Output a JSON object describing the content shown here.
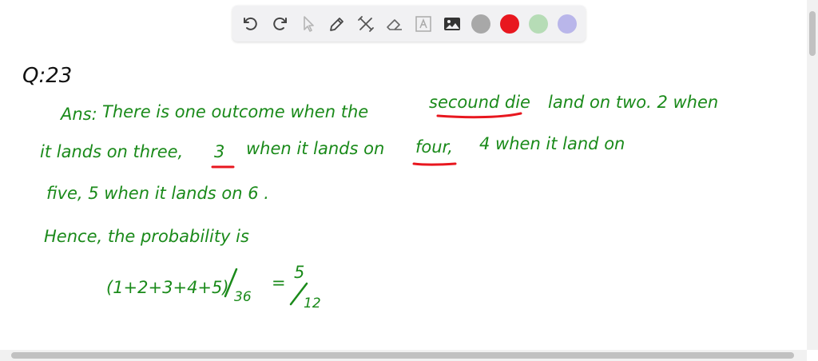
{
  "toolbar": {
    "tools": [
      {
        "name": "undo-icon"
      },
      {
        "name": "redo-icon"
      },
      {
        "name": "select-cursor-icon"
      },
      {
        "name": "pen-icon"
      },
      {
        "name": "tools-icon"
      },
      {
        "name": "eraser-icon"
      },
      {
        "name": "text-icon"
      },
      {
        "name": "image-icon"
      }
    ],
    "colors": [
      {
        "name": "gray",
        "hex": "#a8a8a8"
      },
      {
        "name": "red",
        "hex": "#e8171f"
      },
      {
        "name": "green",
        "hex": "#b6dcb6"
      },
      {
        "name": "lavender",
        "hex": "#b9b6ea"
      }
    ]
  },
  "notes": {
    "question": "Q:23",
    "ans_label": "Ans:",
    "line1": "There  is  one  outcome  when  the",
    "line1_u": "secound  die",
    "line1_end": "land  on  two.  2  when",
    "line2a": "it  lands  on  three,",
    "line2_u1": "3",
    "line2b": "when  it  lands  on",
    "line2_u2": "four,",
    "line2c": "4  when  it  land  on",
    "line3": "five,  5   when  it  lands  on  6 .",
    "line4": "Hence,  the  probability  is",
    "formula_left": "(1+2+3+4+5)",
    "formula_den": "36",
    "equals": "=",
    "result_num": "5",
    "result_den": "12"
  }
}
